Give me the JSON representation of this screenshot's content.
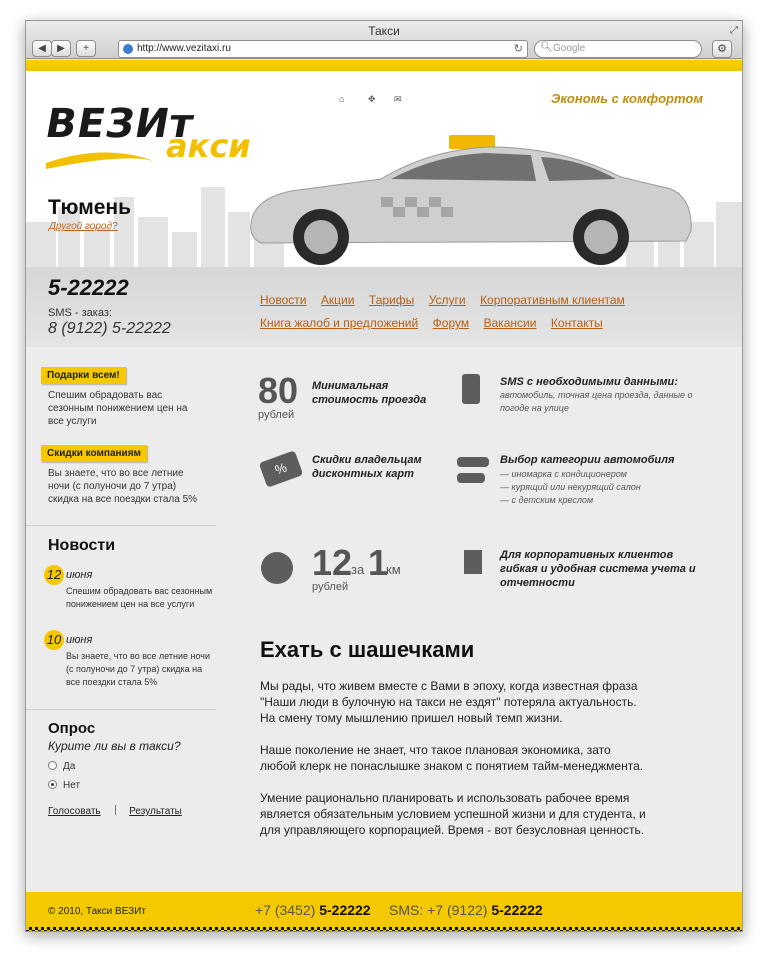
{
  "browser": {
    "window_title": "Такси",
    "url": "http://www.vezitaxi.ru",
    "search_placeholder": "Google",
    "back": "◀",
    "forward": "▶",
    "add": "+",
    "reload": "↻",
    "gear": "⚙",
    "resize": "⤢"
  },
  "header": {
    "logo_main": "ВЕЗИт",
    "logo_sub": "акси",
    "slogan": "Экономь с комфортом",
    "icons": [
      "home-icon",
      "sitemap-icon",
      "mail-icon"
    ],
    "city": "Тюмень",
    "city_link": "Другой город?"
  },
  "contacts": {
    "phone": "5-22222",
    "sms_label": "SMS - заказ:",
    "sms_phone": "8 (9122) 5-22222"
  },
  "nav": {
    "row1": [
      "Новости",
      "Акции",
      "Тарифы",
      "Услуги",
      "Корпоративным клиентам"
    ],
    "row2": [
      "Книга жалоб и предложений",
      "Форум",
      "Вакансии",
      "Контакты"
    ]
  },
  "promos": [
    {
      "badge": "Подарки всем!",
      "text": "Спешим обрадовать вас сезонным понижением цен на все услуги"
    },
    {
      "badge": "Скидки компаниям",
      "text": "Вы знаете, что во все летние ночи (с полуночи до 7 утра) скидка на все поездки стала 5%"
    }
  ],
  "news": {
    "title": "Новости",
    "items": [
      {
        "day": "12",
        "month": "июня",
        "text": "Спешим обрадовать вас сезонным понижением цен на все услуги"
      },
      {
        "day": "10",
        "month": "июня",
        "text": "Вы знаете, что во все летние ночи (с полуночи до 7 утра) скидка на все поездки стала 5%"
      }
    ]
  },
  "poll": {
    "title": "Опрос",
    "question": "Курите ли вы в такси?",
    "options": [
      "Да",
      "Нет"
    ],
    "selected": "Нет",
    "vote": "Голосовать",
    "results": "Результаты"
  },
  "features": {
    "min_price": {
      "value": "80",
      "unit": "рублей",
      "title": "Минимальная стоимость проезда"
    },
    "sms": {
      "title": "SMS с необходимыми данными:",
      "text": "автомобиль, точная цена проезда, данные о погоде на улице"
    },
    "discount": {
      "icon_label": "%",
      "title": "Скидки владельцам дисконтных карт"
    },
    "category": {
      "title": "Выбор категории автомобиля",
      "items": [
        "— иномарка с кондиционером",
        "— курящий или некурящий салон",
        "— с детским креслом"
      ]
    },
    "per_km": {
      "price": "12",
      "unit": "рублей",
      "for": "за",
      "km_value": "1",
      "km_unit": "км"
    },
    "corporate": {
      "title": "Для корпоративных клиентов гибкая и удобная система учета и отчетности"
    }
  },
  "article": {
    "title": "Ехать с шашечками",
    "paragraphs": [
      "Мы рады, что живем вместе с Вами в эпоху, когда известная фраза \"Наши люди в булочную на такси не ездят\" потеряла актуальность. На смену тому мышлению пришел новый темп жизни.",
      "Наше поколение не знает, что такое плановая экономика, зато любой клерк не понаслышке знаком с понятием тайм-менеджмента.",
      "Умение рационально планировать и использовать рабочее время является обязательным условием успешной жизни и для студента, и для управляющего корпорацией. Время - вот безусловная ценность."
    ]
  },
  "footer": {
    "copyright": "© 2010, Такси ВЕЗИт",
    "phone_prefix": "+7 (3452)",
    "phone_number": "5-22222",
    "sms_prefix": "SMS: +7 (9122)",
    "sms_number": "5-22222"
  },
  "colors": {
    "accent_yellow": "#f4c900",
    "link_orange": "#b55f14",
    "slogan_gold": "#c08d10"
  }
}
